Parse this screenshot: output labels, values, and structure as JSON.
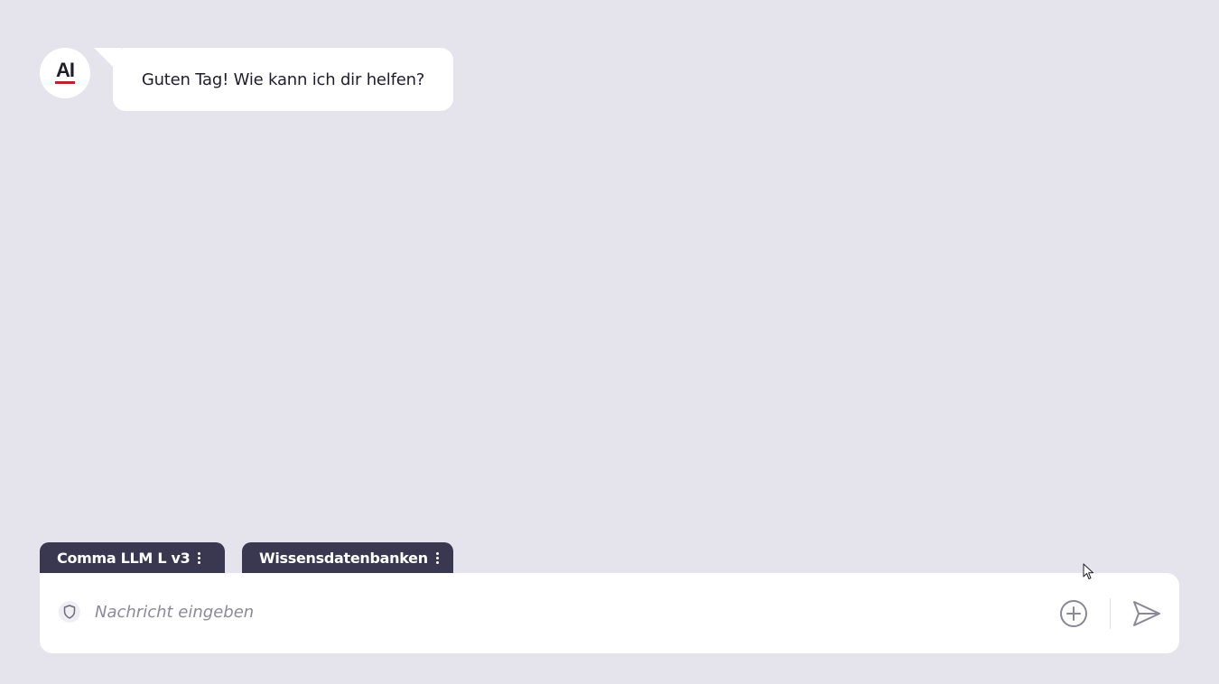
{
  "chat": {
    "avatar_label": "AI",
    "messages": [
      {
        "sender": "assistant",
        "text": "Guten Tag! Wie kann ich dir helfen?"
      }
    ]
  },
  "composer": {
    "tabs": [
      {
        "label": "Comma LLM L v3",
        "menu_icon": "kebab-vertical-icon"
      },
      {
        "label": "Wissensdatenbanken",
        "menu_icon": "kebab-vertical-icon"
      }
    ],
    "input": {
      "placeholder": "Nachricht eingeben",
      "value": ""
    },
    "icons": {
      "privacy": "shield-icon",
      "add": "plus-circle-icon",
      "send": "send-icon"
    }
  },
  "colors": {
    "background": "#e5e4ec",
    "tab_background": "#3a3851",
    "accent_red": "#b3262e",
    "text_dark": "#1f1d2b",
    "placeholder": "#8c8a99"
  }
}
